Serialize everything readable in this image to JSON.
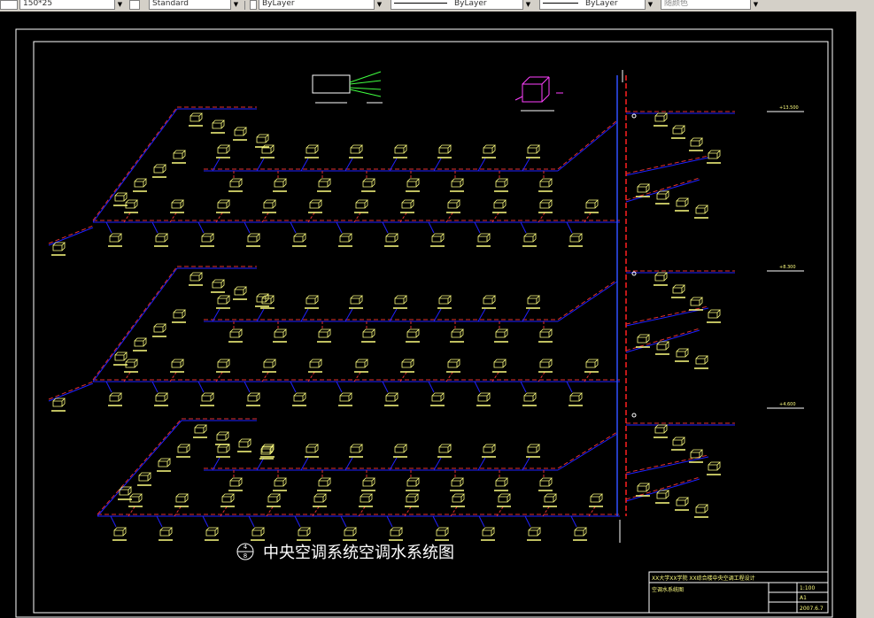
{
  "toolbar": {
    "scale_value": "150*25",
    "text_style": "Standard",
    "layer": "ByLayer",
    "linetype": "ByLayer",
    "lineweight": "ByLayer",
    "plot_style": "随颜色"
  },
  "drawing": {
    "title": "中央空调系统空调水系统图",
    "detail_number": "4",
    "sheet_number": "8",
    "elevation_marks": [
      "+13.500",
      "+8.300",
      "+4.600"
    ],
    "colors": {
      "supply_pipe": "#e03030",
      "return_pipe": "#2020ff",
      "riser_supply": "#ff2020",
      "riser_return": "#3050ff",
      "fan_coil": "#ffff80",
      "frame": "#ffffff",
      "legend_green": "#40ff40",
      "magenta": "#ff40ff"
    }
  },
  "title_block": {
    "line1": "XX大学XX学院 XX综合楼中央空调工程设计",
    "line2": "空调水系统图",
    "scale": "1:100",
    "sheet": "A1",
    "date": "2007.6.7"
  }
}
